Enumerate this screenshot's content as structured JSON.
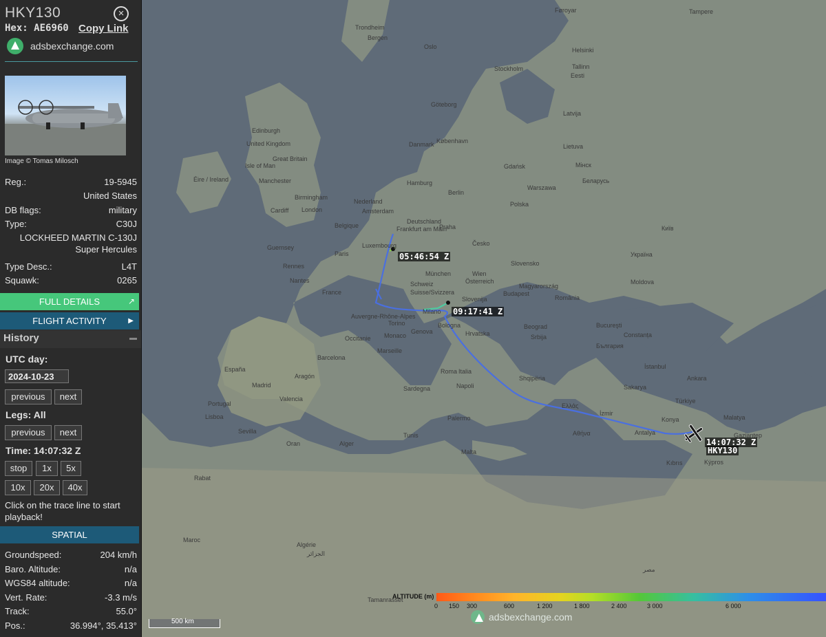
{
  "aircraft": {
    "callsign": "HKY130",
    "hex_label": "Hex:",
    "hex": "AE6960",
    "copy_link": "Copy Link",
    "source": "adsbexchange.com",
    "image_credit": "Image © Tomas Milosch"
  },
  "details": {
    "reg_label": "Reg.:",
    "reg": "19-5945",
    "country": "United States",
    "db_flags_label": "DB flags:",
    "db_flags": "military",
    "type_label": "Type:",
    "type": "C30J",
    "model_line1": "LOCKHEED MARTIN C-130J",
    "model_line2": "Super Hercules",
    "type_desc_label": "Type Desc.:",
    "type_desc": "L4T",
    "squawk_label": "Squawk:",
    "squawk": "0265"
  },
  "buttons": {
    "full_details": "FULL DETAILS",
    "flight_activity": "FLIGHT ACTIVITY"
  },
  "history": {
    "title": "History",
    "utc_day_label": "UTC day:",
    "date": "2024-10-23",
    "previous": "previous",
    "next": "next",
    "legs_label": "Legs: All",
    "time_label": "Time: 14:07:32 Z",
    "stop": "stop",
    "speeds": [
      "1x",
      "5x",
      "10x",
      "20x",
      "40x"
    ],
    "hint": "Click on the trace line to start playback!"
  },
  "spatial": {
    "title": "SPATIAL",
    "groundspeed_label": "Groundspeed:",
    "groundspeed": "204 km/h",
    "baro_label": "Baro. Altitude:",
    "baro": "n/a",
    "wgs_label": "WGS84 altitude:",
    "wgs": "n/a",
    "vrate_label": "Vert. Rate:",
    "vrate": "-3.3 m/s",
    "track_label": "Track:",
    "track": "55.0°",
    "pos_label": "Pos.:",
    "pos": "36.994°, 35.413°"
  },
  "map": {
    "labels": {
      "t1": "05:46:54 Z",
      "t2": "09:17:41 Z",
      "t3": "14:07:32 Z",
      "plane": "HKY130"
    },
    "scale": "500 km",
    "watermark": "adsbexchange.com",
    "altitude_title": "ALTITUDE (m)",
    "altitude_ticks": [
      "0",
      "150",
      "300",
      "600",
      "1 200",
      "1 800",
      "2 400",
      "3 000",
      "6 000"
    ],
    "places": [
      "Føroyar",
      "Trondheim",
      "Tampere",
      "Bergen",
      "Oslo",
      "Helsinki",
      "Stockholm",
      "Tallinn",
      "Eesti",
      "Edinburgh",
      "United Kingdom",
      "Great Britain",
      "Éire / Ireland",
      "Isle of Man",
      "Manchester",
      "Birmingham",
      "London",
      "Cardiff",
      "Göteborg",
      "Danmark",
      "København",
      "Latvija",
      "Lietuva",
      "Gdańsk",
      "Polska",
      "Warszawa",
      "Berlin",
      "Hamburg",
      "Nederland",
      "Amsterdam",
      "Deutschland",
      "Frankfurt am Main",
      "Praha",
      "Česko",
      "Belgique",
      "Luxembourg",
      "Paris",
      "France",
      "Nantes",
      "Rennes",
      "Guernsey",
      "Schweiz",
      "Suisse/Svizzera",
      "München",
      "Wien",
      "Österreich",
      "Slovensko",
      "Magyarország",
      "Budapest",
      "România",
      "Moldova",
      "Україна",
      "Київ",
      "Беларусь",
      "Мінск",
      "Slovenija",
      "Hrvatska",
      "Milano",
      "Torino",
      "Genova",
      "Italia",
      "Roma",
      "Napoli",
      "Bologna",
      "Srbija",
      "Beograd",
      "България",
      "Bucureşti",
      "Constanța",
      "Shqipëria",
      "Ελλάς",
      "Αθήνα",
      "Türkiye",
      "İstanbul",
      "Ankara",
      "Antalya",
      "Konya",
      "İzmir",
      "Kıbrıs",
      "Gaziantep",
      "Malatya",
      "Sakarya",
      "España",
      "Madrid",
      "Valencia",
      "Barcelona",
      "Portugal",
      "Lisboa",
      "Sevilla",
      "Aragón",
      "Occitanie",
      "Auvergne-Rhône-Alpes",
      "Marseille",
      "Monaco",
      "Sardegna",
      "Palermo",
      "Malta",
      "Tunis",
      "Alger",
      "Oran",
      "Maroc",
      "Rabat",
      "Algérie",
      "الجزائر",
      "Tamanrasset",
      "مصر",
      "Kýpros",
      "Nouvelle-Aquitaine",
      "Bretagne",
      "Lyon",
      "Bordeaux",
      "Toulouse",
      "Pamplona",
      "Oviedo",
      "Burgos",
      "Valladolid",
      "Zaragoza",
      "Palma",
      "Almería",
      "Málaga",
      "Dnipro",
      "Odesa",
      "Харків",
      "Sochi",
      "Tbilisi",
      "Yerevan",
      "Trabzon",
      "Erzurum",
      "Diyarbakır",
      "Samsun",
      "Kocaeli",
      "Denizli",
      "Kütahya",
      "Bursa",
      "Balıkesir",
      "Canakkale",
      "Craiova",
      "Varna",
      "Burgas",
      "Plovdiv",
      "Sofia",
      "Skopje",
      "Tiranë",
      "Sarajevo",
      "Split",
      "Zagreb",
      "Ljubljana",
      "Venezia",
      "Trieste",
      "Ancona",
      "Pescara",
      "Bari",
      "Taranto",
      "Catania",
      "Messina",
      "Reggio di Calabria",
      "Sicilia",
      "Cagliari",
      "Corse",
      "Bastia",
      "Nice",
      "Montpellier",
      "Perpignan",
      "Andorra",
      "Girona",
      "Tarragona",
      "Castelló",
      "Alacant",
      "Murcia",
      "Granada",
      "Córdoba",
      "Badajoz",
      "Cáceres",
      "Salamanca",
      "León",
      "Santander",
      "Bilbao",
      "Donostia",
      "Vitoria",
      "Logroño",
      "Soria",
      "Guadalajara",
      "Cuenca",
      "Albacete",
      "Ciudad Real",
      "Toledo",
      "Ávila",
      "Segovia",
      "Zamora",
      "Lugo",
      "Ourense",
      "Vigo",
      "Porto",
      "Coimbra",
      "Braga",
      "Faro",
      "Évora",
      "Setúbal",
      "Huelva",
      "Cádiz",
      "Jerez",
      "Gibraltar",
      "Ceuta",
      "Melilla",
      "Tanger",
      "Tétouan",
      "Fès",
      "Meknès",
      "Casablanca",
      "Marrakech",
      "Agadir"
    ]
  }
}
